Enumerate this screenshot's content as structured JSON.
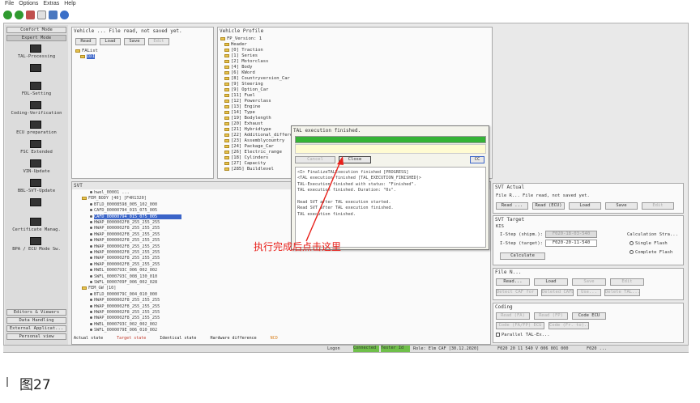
{
  "menu": [
    "File",
    "Options",
    "Extras",
    "Help"
  ],
  "sidebar": {
    "top_buttons": [
      "Comfort Mode",
      "Expert Mode"
    ],
    "items": [
      "TAL-Processing",
      "?",
      "FDL-Setting",
      "Coding-Verification",
      "ECU preparation",
      "FSC Extended",
      "VIN-Update",
      "BBL-SVT-Update",
      "?",
      "Certificate Manag.",
      "BPA / ECU Mode Sw."
    ],
    "bottom_buttons": [
      "Editors & Viewers",
      "Data Handling",
      "External Applicat...",
      "Personal view"
    ]
  },
  "vehicle_panel": {
    "title": "Vehicle ... File read, not saved yet.",
    "buttons": [
      "Read",
      "Load",
      "Save",
      "Edit"
    ],
    "tree_root": "FAList",
    "tree_child": "IDI"
  },
  "profile_panel": {
    "title": "Vehicle Profile",
    "root": "FP_Version: 1",
    "items": [
      "Header",
      "[0] Traction",
      "[1] Series",
      "[2] Motorclass",
      "[4] Body",
      "[6] KWord",
      "[8] Countryversion_Car",
      "[9] Steering",
      "[9] Option_Car",
      "[11] Fuel",
      "[12] Powerclass",
      "[13] Engine",
      "[14] Type",
      "[19] Bodylength",
      "[20] Exhaust",
      "[21] Hybridtype",
      "[22] Additional_differe",
      "[23] Assemblycountry",
      "[24] Package_Car",
      "[26] Electric_range",
      "[18] Cylinders",
      "[27] Capacity",
      "[285] Buildlevel"
    ]
  },
  "svt_panel": {
    "title": "SVT",
    "lines": [
      "hwel_00001 ...",
      "FEM_BODY [40] [F4R1320]",
      "BTLD_00008598_005_102_000",
      "CAFD_00000794_015_075_005",
      "CAFD_00000794_015_075_005",
      "HWAP_0000002F8_255_255_255",
      "HWAP_0000002F8_255_255_255",
      "HWAP_0000002F8_255_255_255",
      "HWAP_0000002F8_255_255_255",
      "HWAP_0000002F8_255_255_255",
      "HWAP_0000002F8_255_255_255",
      "HWAP_0000002F8_255_255_255",
      "HWAP_0000002F8_255_255_255",
      "HWEL_0000793C_006_002_002",
      "SWFL_0000793C_008_130_010",
      "SWFL_0000709F_006_002_028",
      "FEM_GW [10]",
      "BTLD_0000079C_004_010_000",
      "HWAP_0000002F8_255_255_255",
      "HWAP_0000002F8_255_255_255",
      "HWAP_0000002F8_255_255_255",
      "HWAP_0000002F8_255_255_255",
      "HWEL_0000793C_002_002_002",
      "SWFL_0000079E_006_010_002"
    ],
    "legend": [
      "Actual state",
      "Target state",
      "Identical state",
      "Hardware difference",
      "NCD"
    ]
  },
  "modal": {
    "title": "TAL execution finished.",
    "progress_pct": 100,
    "buttons": [
      "Cancel",
      "Close",
      "CC"
    ],
    "log": [
      "<I> FinalizeTALExecution finished [PROGRESS]",
      "<TAL execution finished [TAL_EXECUTION_FINISHED]>",
      "TAL-Execution finished with status: \"Finished\".",
      "TAL execution finished. Duration: \"0s\".",
      "",
      "Read SVT after TAL execution started.",
      "Read SVT after TAL execution finished.",
      "TAL execution finished."
    ]
  },
  "annotation": {
    "text": "执行完成后点击这里",
    "color": "#e8201a"
  },
  "right_panels": {
    "svt_actual": {
      "title": "SVT Actual",
      "file_label": "File R...",
      "file_status": "File read, not saved yet.",
      "buttons": [
        "Read ...",
        "Read (ECU)",
        "Load",
        "Save",
        "Edit"
      ]
    },
    "svt_target": {
      "title": "SVT Target",
      "kis": "KIS",
      "istep_shipm": "I-Step (shipm.):",
      "istep_shipm_val": "F020-18-03-540",
      "istep_target": "I-Step (target):",
      "istep_target_val": "F020-20-11-540",
      "calc_strategy": "Calculation Stra...",
      "single_flash": "Single Flash",
      "complete_flash": "Complete Flash",
      "calculate": "Calculate"
    },
    "file_n": {
      "title": "File N...",
      "buttons": [
        "Read...",
        "Load",
        "Save",
        "Edit"
      ],
      "buttons2": [
        "Detect CAF for SWE",
        "Deleted CAFD...",
        "Use...",
        "Delete TAL..."
      ]
    },
    "coding": {
      "title": "Coding",
      "buttons": [
        "Read (FA)",
        "Read (FP)",
        "Code ECU"
      ],
      "buttons2": [
        "Code (FA/FP) ECU",
        "Code (Fr. to)..."
      ],
      "parallel": "Parallel TAL-Ex..."
    }
  },
  "statusbar": [
    "Logon",
    "Connected",
    "Tester Id",
    "Role: Elm CAF [30.12.2020]",
    "F020 20 11 540 V 006 001 000",
    "F020 ..."
  ],
  "caption": "图27"
}
